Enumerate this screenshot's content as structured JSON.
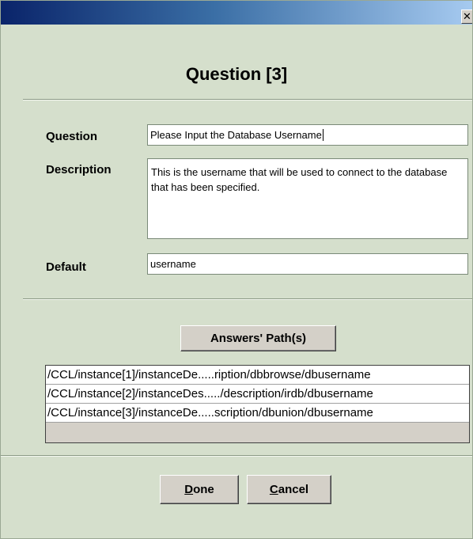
{
  "window": {
    "close_glyph": "✕",
    "close_icon": "close-icon"
  },
  "dialog": {
    "title": "Question [3]"
  },
  "form": {
    "question_label": "Question",
    "question_value": "Please Input the Database Username",
    "description_label": "Description",
    "description_value": "This is the username that will be used to connect to the database that has been specified.",
    "default_label": "Default",
    "default_value": "username"
  },
  "answers": {
    "button_label": "Answers' Path(s)",
    "paths": [
      "/CCL/instance[1]/instanceDe.....ription/dbbrowse/dbusername",
      "/CCL/instance[2]/instanceDes...../description/irdb/dbusername",
      "/CCL/instance[3]/instanceDe.....scription/dbunion/dbusername"
    ]
  },
  "footer": {
    "done_mnemonic": "D",
    "done_rest": "one",
    "cancel_mnemonic": "C",
    "cancel_rest": "ancel"
  },
  "colors": {
    "dialog_background": "#d5dfcc",
    "titlebar_start": "#0a246a",
    "titlebar_end": "#a6caf0",
    "button_face": "#d4d0c8"
  }
}
